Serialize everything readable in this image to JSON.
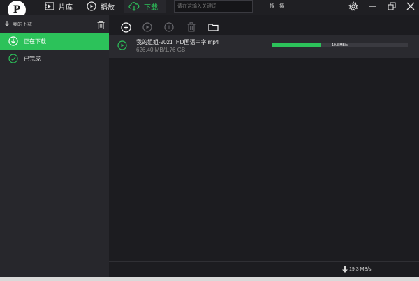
{
  "app": {
    "logo_letter": "P",
    "accent_color": "#2cc25a"
  },
  "nav": {
    "tabs": [
      {
        "label": "片库",
        "icon": "library-icon"
      },
      {
        "label": "播放",
        "icon": "play-circle-icon"
      },
      {
        "label": "下载",
        "icon": "cloud-download-icon",
        "active": true
      }
    ],
    "search": {
      "placeholder": "请在这输入关键词",
      "button_label": "搜一搜"
    },
    "window_controls": [
      "settings-icon",
      "minimize-icon",
      "restore-icon",
      "close-icon"
    ]
  },
  "sidebar": {
    "title": "我的下载",
    "items": [
      {
        "label": "正在下载",
        "icon": "download-circle-icon",
        "active": true
      },
      {
        "label": "已完成",
        "icon": "check-circle-icon",
        "active": false
      }
    ]
  },
  "toolbar": {
    "buttons": [
      "add-icon",
      "play-icon",
      "pause-icon",
      "delete-icon",
      "folder-icon"
    ]
  },
  "downloads": [
    {
      "name": "我的姐姐-2021_HD国语中字.mp4",
      "size": "626.40 MB/1.76 GB",
      "progress": 0.36,
      "speed": "19.3 MB/s"
    }
  ],
  "status": {
    "total_speed": "19.3 MB/s"
  }
}
